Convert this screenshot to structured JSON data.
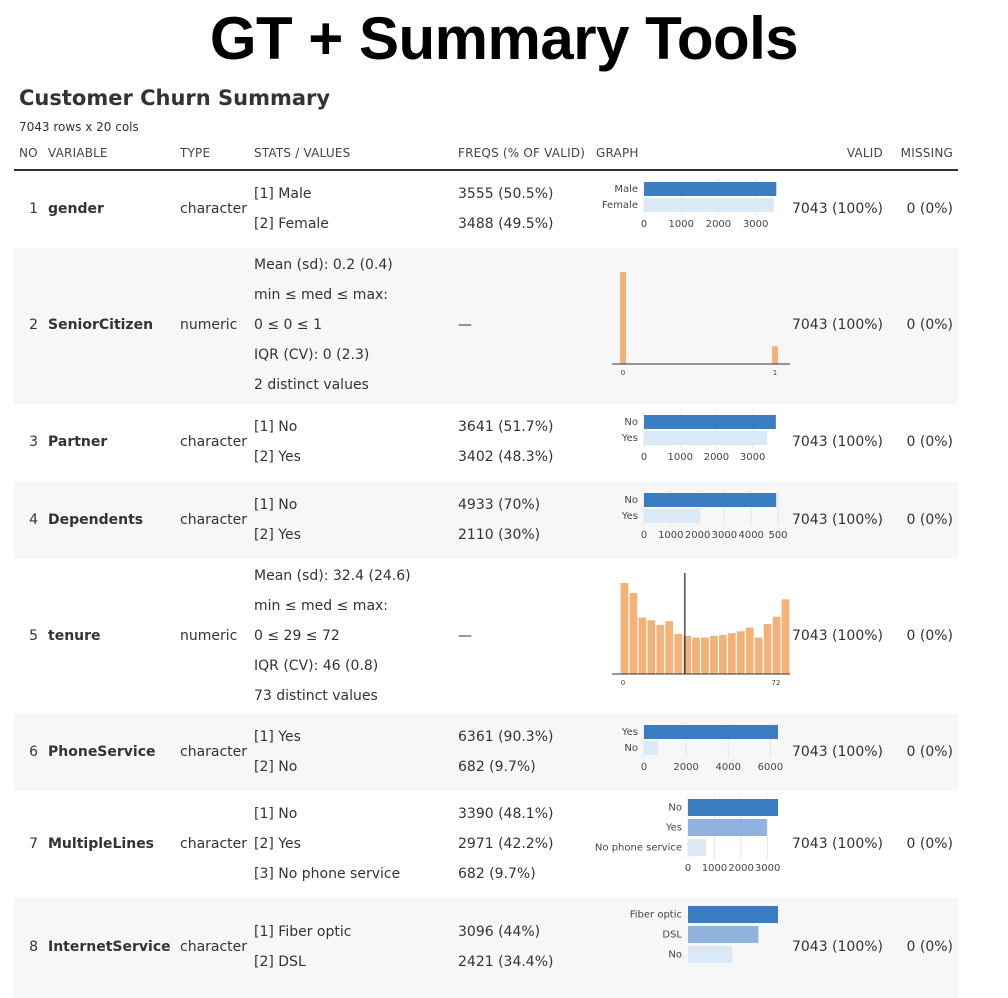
{
  "banner": "GT + Summary Tools",
  "table": {
    "title": "Customer Churn Summary",
    "subtitle": "7043 rows x 20 cols",
    "headers": {
      "no": "NO",
      "variable": "VARIABLE",
      "type": "TYPE",
      "stats": "STATS / VALUES",
      "freqs": "FREQS (% OF VALID)",
      "graph": "GRAPH",
      "valid": "VALID",
      "missing": "MISSING"
    }
  },
  "rows": [
    {
      "no": "1",
      "variable": "gender",
      "type": "character",
      "stats": [
        "[1] Male",
        "[2] Female"
      ],
      "freqs": [
        "3555 (50.5%)",
        "3488 (49.5%)"
      ],
      "valid": "7043 (100%)",
      "missing": "0 (0%)"
    },
    {
      "no": "2",
      "variable": "SeniorCitizen",
      "type": "numeric",
      "stats": [
        "Mean (sd): 0.2 (0.4)",
        "min ≤ med ≤ max:",
        "0 ≤ 0 ≤ 1",
        "IQR (CV): 0 (2.3)",
        "2 distinct values"
      ],
      "freqs_dash": "—",
      "valid": "7043 (100%)",
      "missing": "0 (0%)"
    },
    {
      "no": "3",
      "variable": "Partner",
      "type": "character",
      "stats": [
        "[1] No",
        "[2] Yes"
      ],
      "freqs": [
        "3641 (51.7%)",
        "3402 (48.3%)"
      ],
      "valid": "7043 (100%)",
      "missing": "0 (0%)"
    },
    {
      "no": "4",
      "variable": "Dependents",
      "type": "character",
      "stats": [
        "[1] No",
        "[2] Yes"
      ],
      "freqs": [
        "4933 (70%)",
        "2110 (30%)"
      ],
      "valid": "7043 (100%)",
      "missing": "0 (0%)"
    },
    {
      "no": "5",
      "variable": "tenure",
      "type": "numeric",
      "stats": [
        "Mean (sd): 32.4 (24.6)",
        "min ≤ med ≤ max:",
        "0 ≤ 29 ≤ 72",
        "IQR (CV): 46 (0.8)",
        "73 distinct values"
      ],
      "freqs_dash": "—",
      "valid": "7043 (100%)",
      "missing": "0 (0%)"
    },
    {
      "no": "6",
      "variable": "PhoneService",
      "type": "character",
      "stats": [
        "[1] Yes",
        "[2] No"
      ],
      "freqs": [
        "6361 (90.3%)",
        "682 (9.7%)"
      ],
      "valid": "7043 (100%)",
      "missing": "0 (0%)"
    },
    {
      "no": "7",
      "variable": "MultipleLines",
      "type": "character",
      "stats": [
        "[1] No",
        "[2] Yes",
        "[3] No phone service"
      ],
      "freqs": [
        "3390 (48.1%)",
        "2971 (42.2%)",
        "682 (9.7%)"
      ],
      "valid": "7043 (100%)",
      "missing": "0 (0%)"
    },
    {
      "no": "8",
      "variable": "InternetService",
      "type": "character",
      "stats": [
        "[1] Fiber optic",
        "[2] DSL"
      ],
      "freqs": [
        "3096 (44%)",
        "2421 (34.4%)"
      ],
      "valid": "7043 (100%)",
      "missing": "0 (0%)"
    }
  ],
  "chart_data": [
    {
      "type": "bar",
      "orientation": "horizontal",
      "categories": [
        "Male",
        "Female"
      ],
      "values": [
        3555,
        3488
      ],
      "xticks": [
        "0",
        "1000",
        "2000",
        "3000"
      ],
      "xlim": [
        0,
        3600
      ],
      "colors": [
        "#3a7dc1",
        "#dbe9f7"
      ]
    },
    {
      "type": "histogram",
      "bins_x": [
        0,
        1
      ],
      "values": [
        5901,
        1142
      ],
      "xticks": [
        "0",
        "1"
      ],
      "xlim": [
        0,
        1
      ],
      "color": "#f2b27a"
    },
    {
      "type": "bar",
      "orientation": "horizontal",
      "categories": [
        "No",
        "Yes"
      ],
      "values": [
        3641,
        3402
      ],
      "xticks": [
        "0",
        "1000",
        "2000",
        "3000"
      ],
      "xlim": [
        0,
        3700
      ],
      "colors": [
        "#3a7dc1",
        "#dbe9f7"
      ]
    },
    {
      "type": "bar",
      "orientation": "horizontal",
      "categories": [
        "No",
        "Yes"
      ],
      "values": [
        4933,
        2110
      ],
      "xticks": [
        "0",
        "1000",
        "2000",
        "3000",
        "4000",
        "500"
      ],
      "xlim": [
        0,
        5000
      ],
      "colors": [
        "#3a7dc1",
        "#dbe9f7"
      ]
    },
    {
      "type": "histogram",
      "values": [
        1000,
        890,
        620,
        590,
        540,
        580,
        440,
        420,
        400,
        400,
        420,
        430,
        450,
        470,
        510,
        400,
        550,
        630,
        820
      ],
      "xticks": [
        "0",
        "72"
      ],
      "xlim": [
        0,
        72
      ],
      "median": 29,
      "color": "#f2b27a"
    },
    {
      "type": "bar",
      "orientation": "horizontal",
      "categories": [
        "Yes",
        "No"
      ],
      "values": [
        6361,
        682
      ],
      "xticks": [
        "0",
        "2000",
        "4000",
        "6000"
      ],
      "xlim": [
        0,
        6361
      ],
      "colors": [
        "#3a7dc1",
        "#dbe9f7"
      ]
    },
    {
      "type": "bar",
      "orientation": "horizontal",
      "categories": [
        "No",
        "Yes",
        "No phone service"
      ],
      "values": [
        3390,
        2971,
        682
      ],
      "xticks": [
        "0",
        "1000",
        "2000",
        "3000"
      ],
      "xlim": [
        0,
        3390
      ],
      "colors": [
        "#3a7dc1",
        "#8fb3de",
        "#dbe9f7"
      ]
    },
    {
      "type": "bar",
      "orientation": "horizontal",
      "categories": [
        "Fiber optic",
        "DSL",
        "No"
      ],
      "values": [
        3096,
        2421,
        1526
      ],
      "xticks": [],
      "xlim": [
        0,
        3096
      ],
      "colors": [
        "#3a7dc1",
        "#8fb3de",
        "#dbe9f7"
      ]
    }
  ]
}
